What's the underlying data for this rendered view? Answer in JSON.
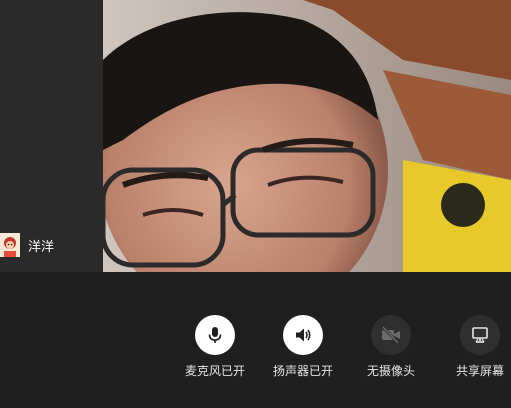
{
  "participant": {
    "name": "洋洋",
    "avatar_icon": "cartoon-avatar-icon"
  },
  "toolbar": {
    "mic": {
      "label": "麦克风已开",
      "icon": "microphone-icon",
      "state": "on"
    },
    "speaker": {
      "label": "扬声器已开",
      "icon": "speaker-icon",
      "state": "on"
    },
    "camera": {
      "label": "无摄像头",
      "icon": "camera-off-icon",
      "state": "off"
    },
    "share": {
      "label": "共享屏幕",
      "icon": "screen-share-icon",
      "state": "off"
    }
  },
  "colors": {
    "background": "#1f1f1f",
    "sidebar": "#2a2a2a",
    "active_button": "#ffffff",
    "inactive_button": "#2f2f2f"
  }
}
